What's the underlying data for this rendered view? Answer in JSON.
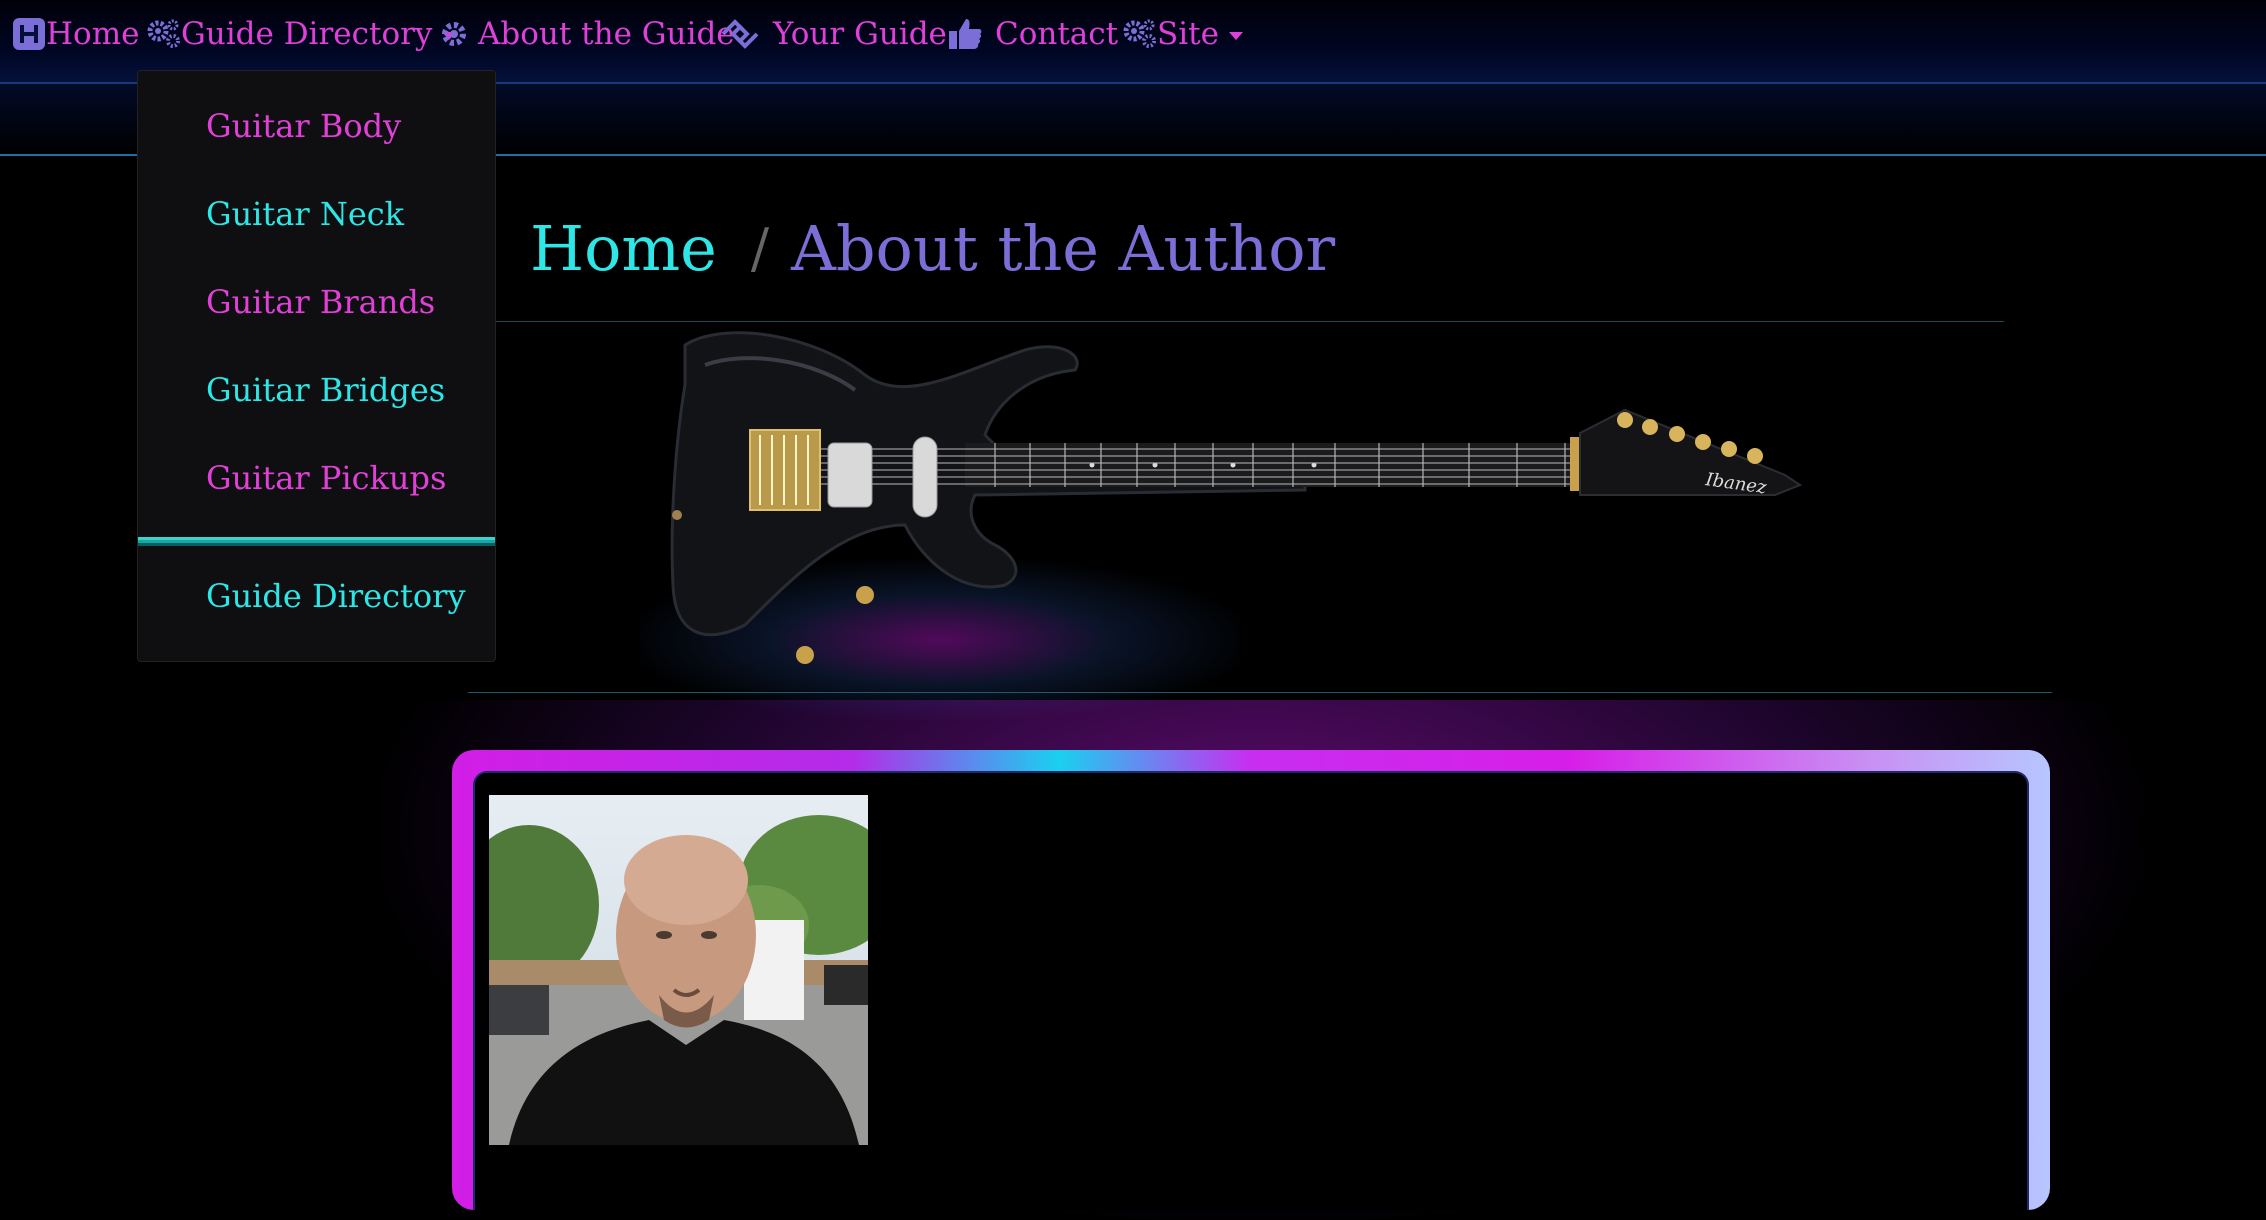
{
  "nav": {
    "home": "Home",
    "guide_directory": "Guide Directory",
    "about_guide": "About the Guide",
    "your_guide": "Your Guide",
    "contact": "Contact",
    "site": "Site"
  },
  "dropdown": {
    "items": [
      "Guitar Body",
      "Guitar Neck",
      "Guitar Brands",
      "Guitar Bridges",
      "Guitar Pickups"
    ],
    "footer_item": "Guide Directory"
  },
  "breadcrumb": {
    "home": "Home",
    "separator": "/",
    "current": "About the Author"
  },
  "guitar": {
    "brand_logo": "Ibanez"
  },
  "colors": {
    "accent_pink": "#e040d8",
    "accent_cyan": "#2ee6e6",
    "accent_purple": "#7b6ed6"
  }
}
